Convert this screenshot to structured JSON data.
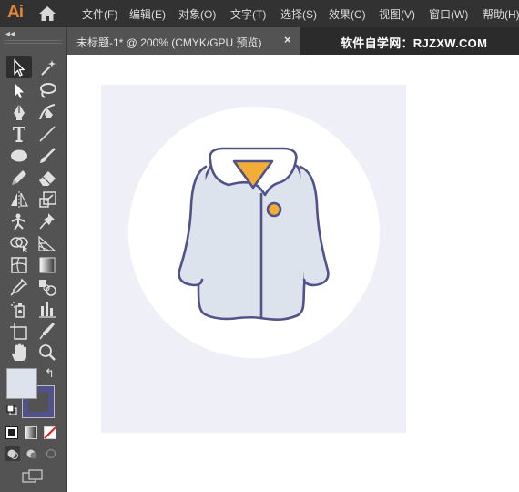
{
  "app": {
    "logo": "Ai",
    "home_icon": "home-icon"
  },
  "menu": [
    {
      "id": "file",
      "label": "文件(F)"
    },
    {
      "id": "edit",
      "label": "编辑(E)"
    },
    {
      "id": "object",
      "label": "对象(O)"
    },
    {
      "id": "type",
      "label": "文字(T)"
    },
    {
      "id": "select",
      "label": "选择(S)"
    },
    {
      "id": "effect",
      "label": "效果(C)"
    },
    {
      "id": "view",
      "label": "视图(V)"
    },
    {
      "id": "window",
      "label": "窗口(W)"
    },
    {
      "id": "help",
      "label": "帮助(H)"
    }
  ],
  "document_tab": {
    "title": "未标题-1* @ 200% (CMYK/GPU 预览)",
    "close_icon": "×"
  },
  "watermark": "软件自学网：RJZXW.COM",
  "toolbar": {
    "collapse_icon": "◂◂",
    "tools": [
      "selection-tool-icon",
      "magic-wand-icon",
      "direct-selection-icon",
      "lasso-icon",
      "pen-icon",
      "curvature-icon",
      "type-icon",
      "line-segment-icon",
      "ellipse-icon",
      "paintbrush-icon",
      "pencil-icon",
      "eraser-icon",
      "reflect-icon",
      "scale-icon",
      "puppet-warp-icon",
      "pin-icon",
      "shape-builder-icon",
      "perspective-grid-icon",
      "mesh-icon",
      "gradient-icon",
      "eyedropper-icon",
      "blend-icon",
      "symbol-sprayer-icon",
      "column-graph-icon",
      "artboard-icon",
      "slice-icon",
      "hand-icon",
      "zoom-icon"
    ],
    "selected_tool": "selection-tool-icon",
    "swap_icon": "↰",
    "colors": {
      "fill": "#dde3ec",
      "stroke": "#51528a"
    }
  },
  "artwork": {
    "artboard_color": "#efeff8",
    "circle_color": "#ffffff",
    "coat_fill": "#dde3ec",
    "coat_stroke": "#51528a",
    "collar_fill": "#ffffff",
    "scarf_fill": "#f2ad36",
    "button_fill": "#f2ad36"
  }
}
